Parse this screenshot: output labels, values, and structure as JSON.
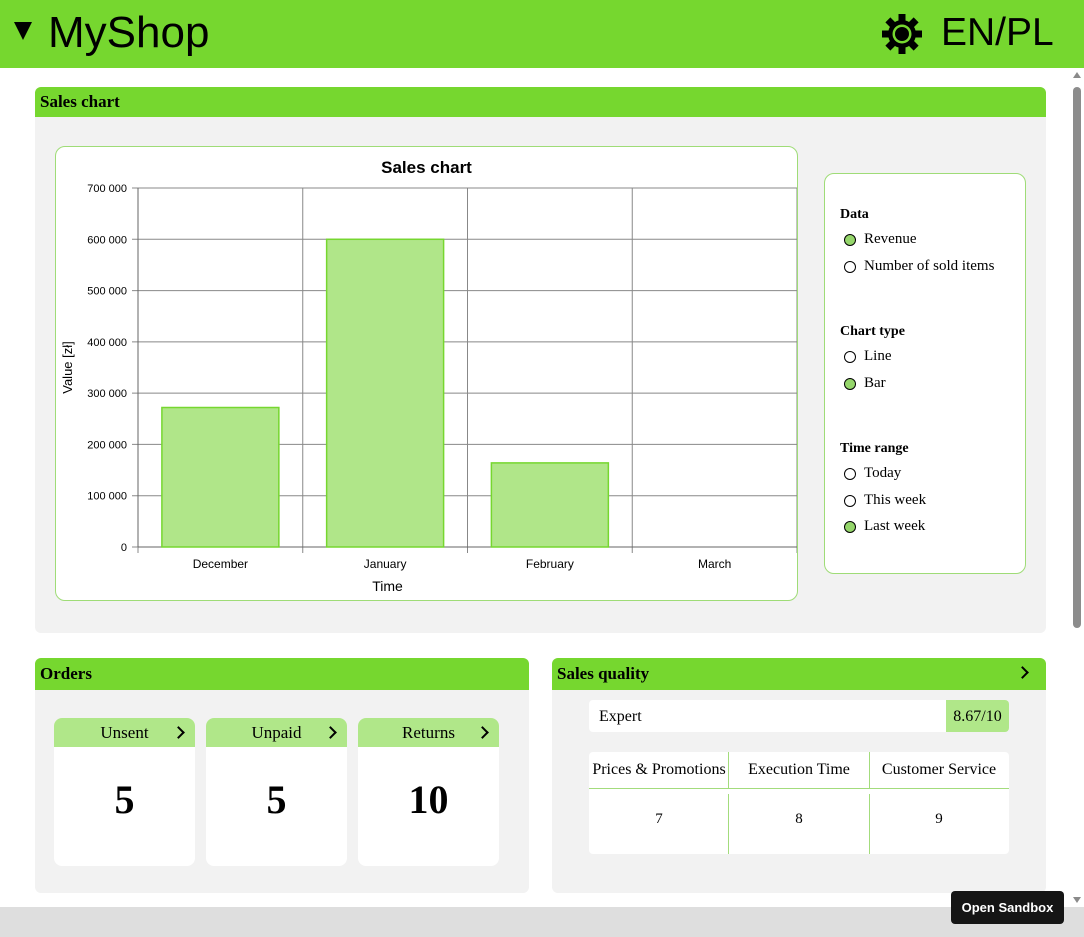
{
  "header": {
    "title": "MyShop",
    "lang": "EN/PL"
  },
  "sales_panel": {
    "title": "Sales chart",
    "options": {
      "data_title": "Data",
      "data_options": [
        {
          "label": "Revenue",
          "selected": true
        },
        {
          "label": "Number of sold items",
          "selected": false
        }
      ],
      "type_title": "Chart type",
      "type_options": [
        {
          "label": "Line",
          "selected": false
        },
        {
          "label": "Bar",
          "selected": true
        }
      ],
      "range_title": "Time range",
      "range_options": [
        {
          "label": "Today",
          "selected": false
        },
        {
          "label": "This week",
          "selected": false
        },
        {
          "label": "Last week",
          "selected": true
        }
      ]
    }
  },
  "chart_data": {
    "type": "bar",
    "title": "Sales chart",
    "xlabel": "Time",
    "ylabel": "Value [zł]",
    "categories": [
      "December",
      "January",
      "February",
      "March"
    ],
    "values": [
      272000,
      600000,
      164000,
      0
    ],
    "ylim": [
      0,
      700000
    ],
    "yticks": [
      "0",
      "100 000",
      "200 000",
      "300 000",
      "400 000",
      "500 000",
      "600 000",
      "700 000"
    ],
    "grid": true,
    "bar_color": "#b0e689",
    "bar_stroke": "#76d72f"
  },
  "orders": {
    "title": "Orders",
    "cards": [
      {
        "label": "Unsent",
        "value": "5"
      },
      {
        "label": "Unpaid",
        "value": "5"
      },
      {
        "label": "Returns",
        "value": "10"
      }
    ]
  },
  "quality": {
    "title": "Sales quality",
    "expert_label": "Expert",
    "expert_score": "8.67/10",
    "columns": [
      "Prices & Promotions",
      "Execution Time",
      "Customer Service"
    ],
    "scores": [
      "7",
      "8",
      "9"
    ]
  },
  "sandbox_button": "Open Sandbox",
  "colors": {
    "accent": "#76d72f",
    "accent_light": "#b0e789",
    "panel_bg": "#f2f2f2"
  }
}
